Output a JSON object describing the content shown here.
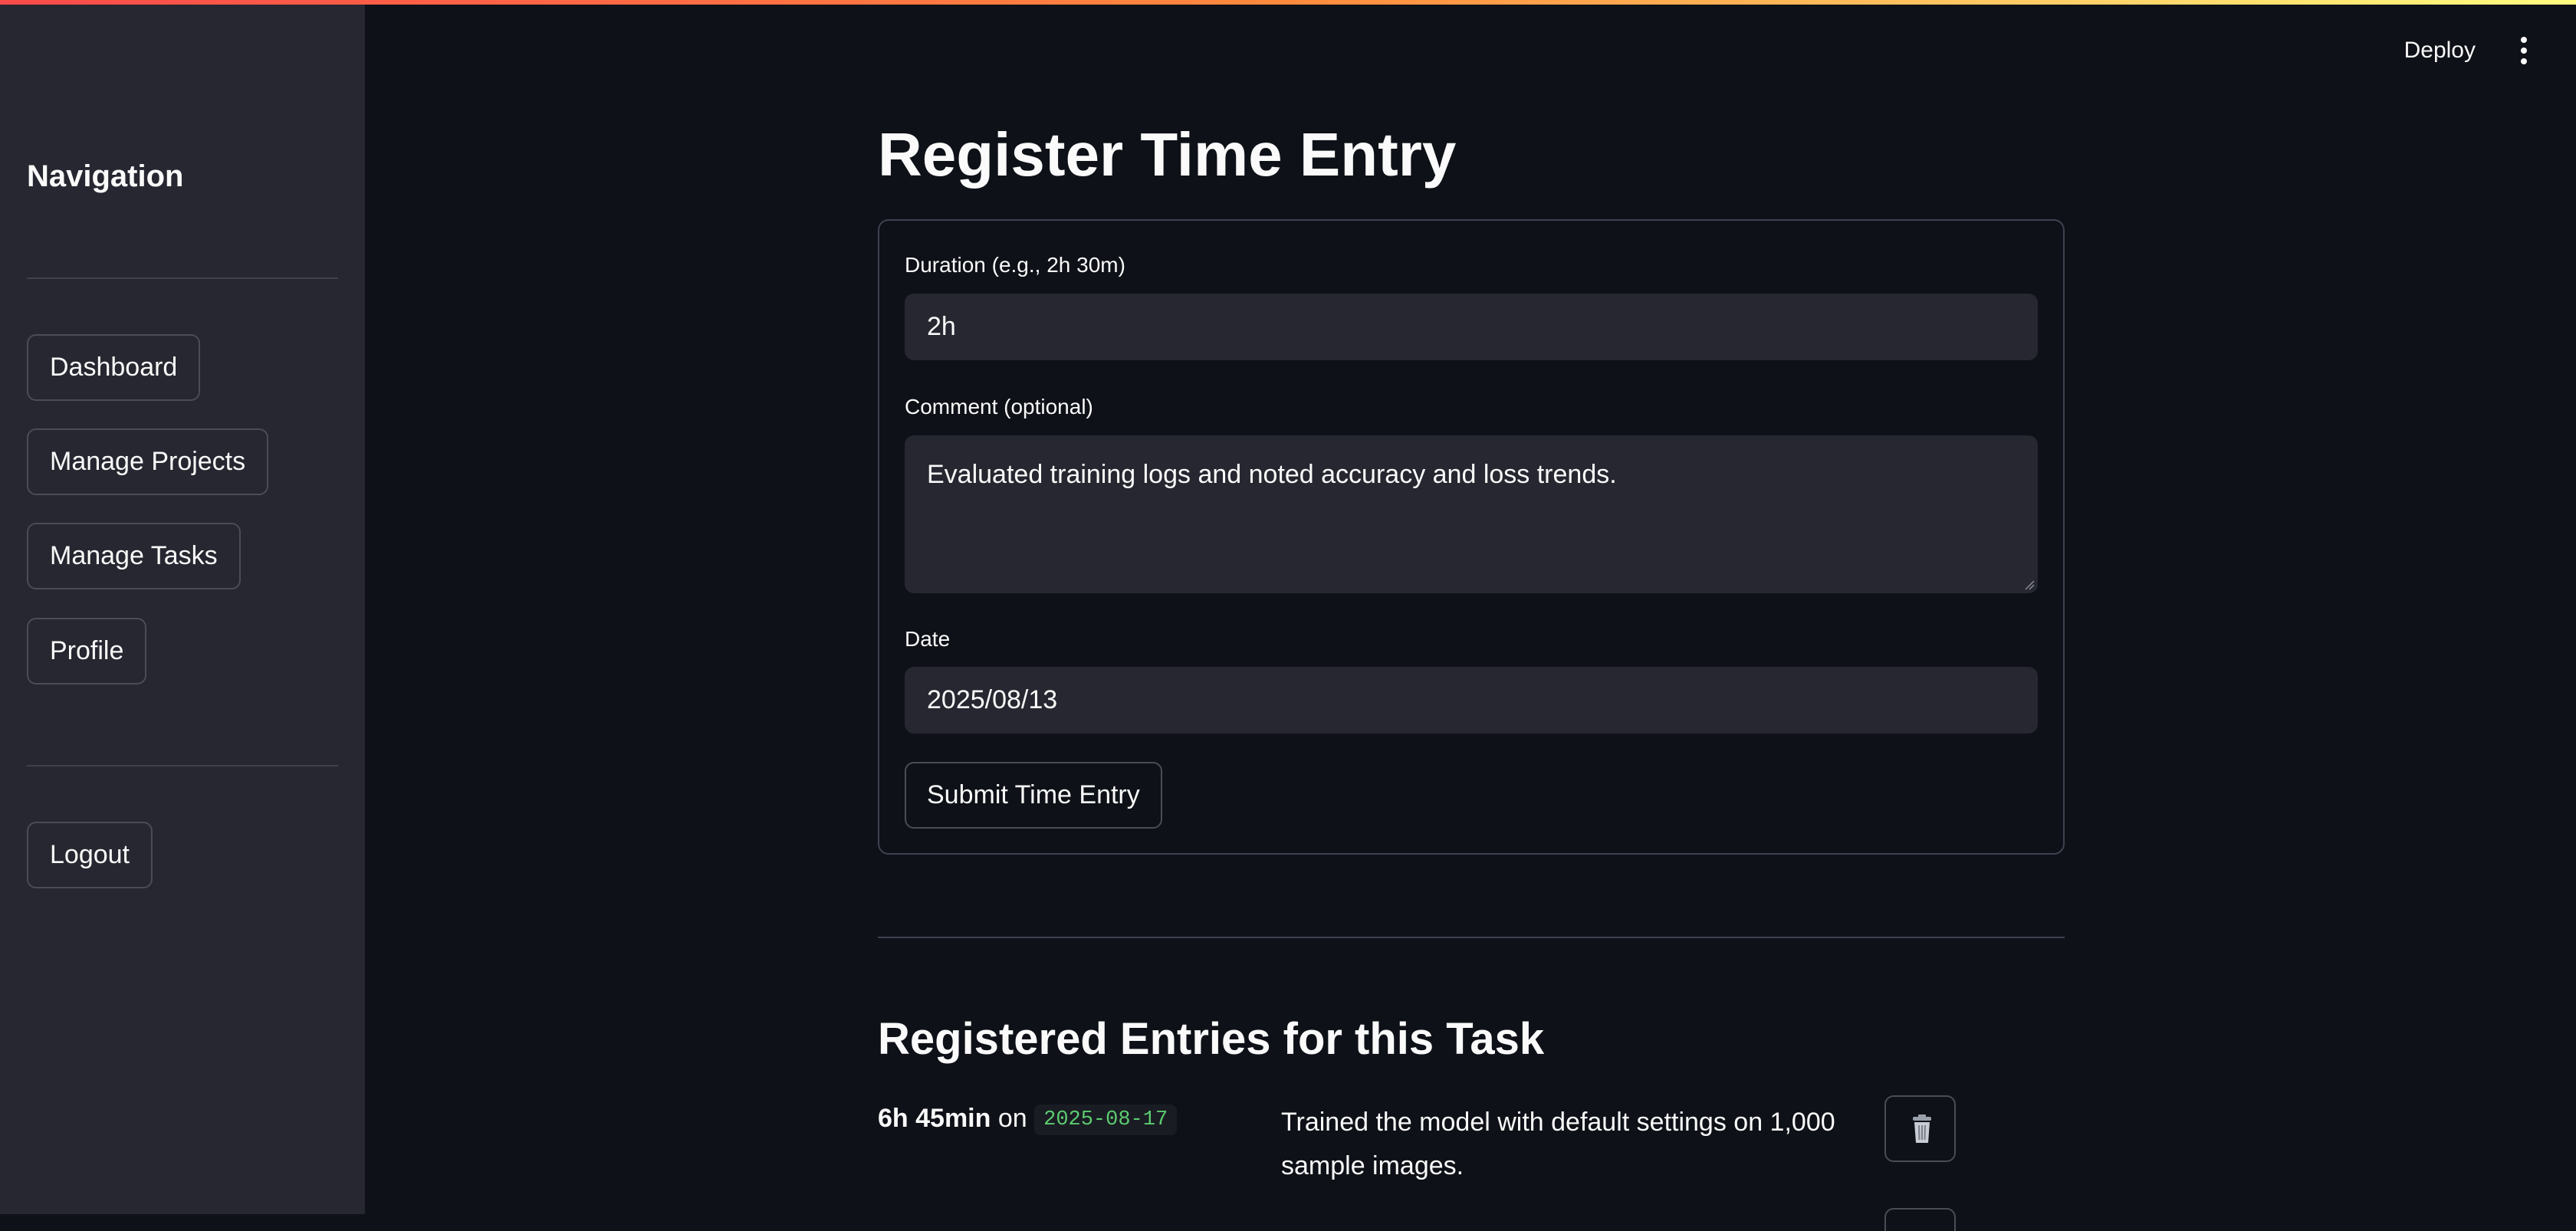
{
  "sidebar": {
    "title": "Navigation",
    "nav_items": [
      {
        "label": "Dashboard"
      },
      {
        "label": "Manage Projects"
      },
      {
        "label": "Manage Tasks"
      },
      {
        "label": "Profile"
      }
    ],
    "logout_label": "Logout"
  },
  "header": {
    "deploy_label": "Deploy",
    "menu_icon": "vertical-ellipsis-icon"
  },
  "main": {
    "title": "Register Time Entry",
    "form": {
      "duration_label": "Duration (e.g., 2h 30m)",
      "duration_value": "2h",
      "comment_label": "Comment (optional)",
      "comment_value": "Evaluated training logs and noted accuracy and loss trends.",
      "date_label": "Date",
      "date_value": "2025/08/13",
      "submit_label": "Submit Time Entry"
    },
    "entries_title": "Registered Entries for this Task",
    "entries": [
      {
        "duration": "6h 45min",
        "on_text": "on",
        "date": "2025-08-17",
        "comment": "Trained the model with default settings on 1,000 sample images.",
        "delete_icon": "trash-icon"
      }
    ]
  },
  "colors": {
    "background": "#0e1117",
    "sidebar": "#262730",
    "input": "#262730",
    "border": "#4a4c58",
    "date_code": "#5ccc70",
    "accent_gradient_start": "#ff4b4b",
    "accent_gradient_end": "#fffd80"
  }
}
